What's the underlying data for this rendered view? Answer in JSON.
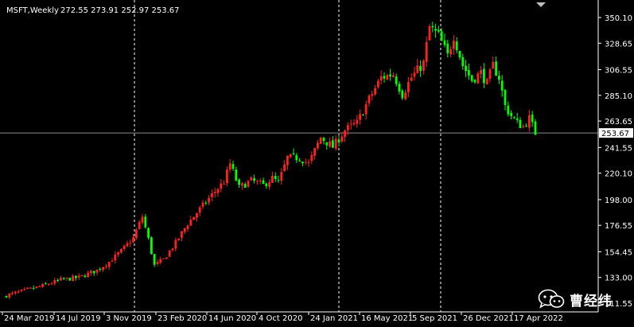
{
  "window": {
    "symbol_label": "MSFT,Weekly",
    "ohlc_label": "272.55 273.91 252.97 253.67"
  },
  "colors": {
    "background": "#000000",
    "up": "#ff2020",
    "down": "#00ff00",
    "axis": "#ffffff",
    "current_line": "#8c8c8c"
  },
  "watermark": {
    "text": "曹经纬",
    "icon": "wechat-logo-icon"
  },
  "chart_data": {
    "type": "candlestick",
    "title": "MSFT,Weekly",
    "ylim": [
      113.5,
      356.5
    ],
    "y_ticks": [
      "350.10",
      "328.65",
      "306.55",
      "285.10",
      "263.65",
      "241.55",
      "220.10",
      "198.00",
      "176.55",
      "154.45",
      "133.00",
      "111.55"
    ],
    "x_ticks": [
      "24 Mar 2019",
      "14 Jul 2019",
      "3 Nov 2019",
      "23 Feb 2020",
      "14 Jun 2020",
      "4 Oct 2020",
      "24 Jan 2021",
      "16 May 2021",
      "5 Sep 2021",
      "26 Dec 2021",
      "17 Apr 2022"
    ],
    "current_price": "253.67",
    "grid": false,
    "dashed_separators_at": [
      "3 Nov 2019",
      "24 Jan 2021",
      "5 Sep 2021"
    ],
    "close_anchors": [
      [
        0,
        118
      ],
      [
        6,
        122
      ],
      [
        12,
        126
      ],
      [
        18,
        131
      ],
      [
        24,
        133
      ],
      [
        30,
        139
      ],
      [
        34,
        146
      ],
      [
        38,
        155
      ],
      [
        42,
        166
      ],
      [
        45,
        184
      ],
      [
        47,
        165
      ],
      [
        49,
        143
      ],
      [
        52,
        148
      ],
      [
        56,
        162
      ],
      [
        60,
        178
      ],
      [
        64,
        190
      ],
      [
        68,
        202
      ],
      [
        72,
        213
      ],
      [
        74,
        228
      ],
      [
        77,
        208
      ],
      [
        81,
        214
      ],
      [
        85,
        210
      ],
      [
        88,
        216
      ],
      [
        90,
        212
      ],
      [
        93,
        233
      ],
      [
        97,
        233
      ],
      [
        100,
        228
      ],
      [
        104,
        250
      ],
      [
        108,
        242
      ],
      [
        112,
        256
      ],
      [
        116,
        262
      ],
      [
        120,
        282
      ],
      [
        124,
        300
      ],
      [
        128,
        303
      ],
      [
        131,
        286
      ],
      [
        134,
        300
      ],
      [
        138,
        312
      ],
      [
        140,
        342
      ],
      [
        143,
        335
      ],
      [
        146,
        318
      ],
      [
        148,
        335
      ],
      [
        151,
        310
      ],
      [
        154,
        298
      ],
      [
        157,
        304
      ],
      [
        159,
        295
      ],
      [
        161,
        310
      ],
      [
        163,
        300
      ],
      [
        165,
        276
      ],
      [
        167,
        268
      ],
      [
        169,
        262
      ],
      [
        171,
        259
      ],
      [
        173,
        266
      ],
      [
        175,
        253.67
      ]
    ]
  }
}
